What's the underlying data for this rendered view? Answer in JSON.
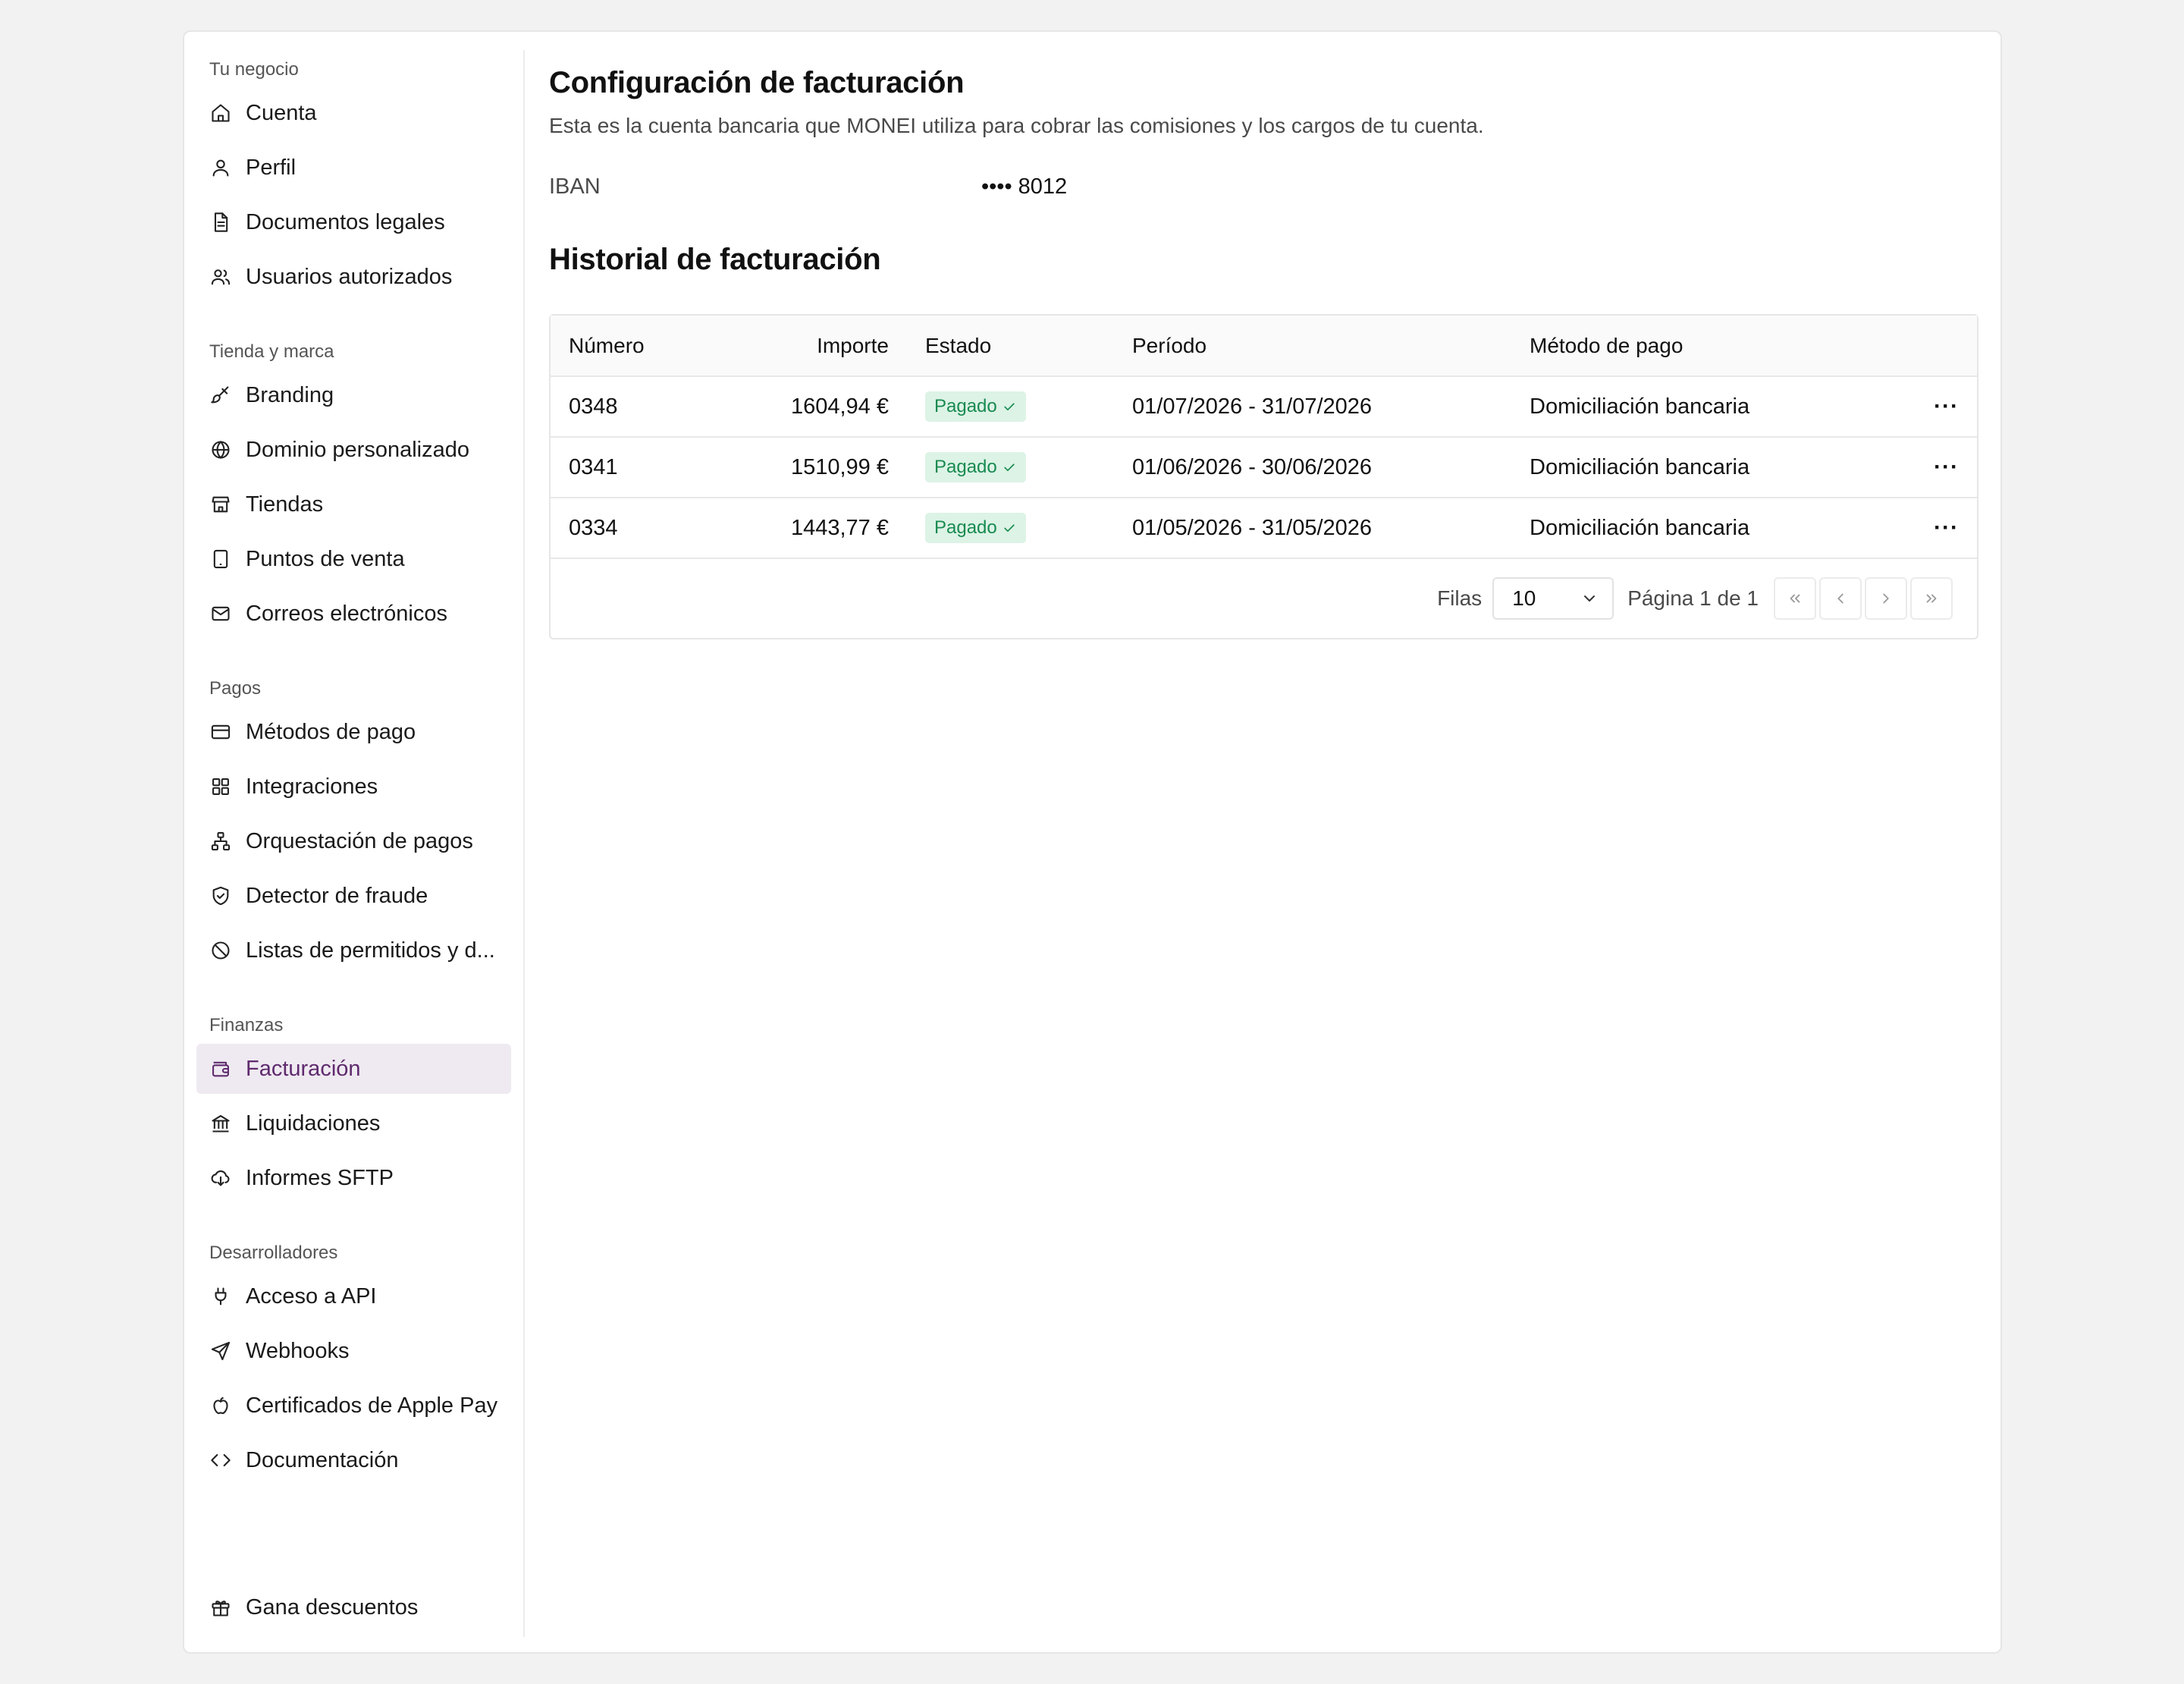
{
  "sidebar": {
    "sections": [
      {
        "title": "Tu negocio",
        "items": [
          {
            "label": "Cuenta",
            "icon": "home-icon"
          },
          {
            "label": "Perfil",
            "icon": "user-icon"
          },
          {
            "label": "Documentos legales",
            "icon": "document-icon"
          },
          {
            "label": "Usuarios autorizados",
            "icon": "users-icon"
          }
        ]
      },
      {
        "title": "Tienda y marca",
        "items": [
          {
            "label": "Branding",
            "icon": "brush-icon"
          },
          {
            "label": "Dominio personalizado",
            "icon": "globe-icon"
          },
          {
            "label": "Tiendas",
            "icon": "store-icon"
          },
          {
            "label": "Puntos de venta",
            "icon": "tablet-icon"
          },
          {
            "label": "Correos electrónicos",
            "icon": "mail-icon"
          }
        ]
      },
      {
        "title": "Pagos",
        "items": [
          {
            "label": "Métodos de pago",
            "icon": "credit-card-icon"
          },
          {
            "label": "Integraciones",
            "icon": "grid-icon"
          },
          {
            "label": "Orquestación de pagos",
            "icon": "network-icon"
          },
          {
            "label": "Detector de fraude",
            "icon": "shield-check-icon"
          },
          {
            "label": "Listas de permitidos y d...",
            "icon": "ban-icon"
          }
        ]
      },
      {
        "title": "Finanzas",
        "items": [
          {
            "label": "Facturación",
            "icon": "wallet-icon",
            "active": true
          },
          {
            "label": "Liquidaciones",
            "icon": "bank-icon"
          },
          {
            "label": "Informes SFTP",
            "icon": "cloud-download-icon"
          }
        ]
      },
      {
        "title": "Desarrolladores",
        "items": [
          {
            "label": "Acceso a API",
            "icon": "plug-icon"
          },
          {
            "label": "Webhooks",
            "icon": "send-icon"
          },
          {
            "label": "Certificados de Apple Pay",
            "icon": "apple-icon"
          },
          {
            "label": "Documentación",
            "icon": "code-icon"
          }
        ]
      }
    ],
    "footer_item": {
      "label": "Gana descuentos",
      "icon": "gift-icon"
    }
  },
  "billing": {
    "title": "Configuración de facturación",
    "description": "Esta es la cuenta bancaria que MONEI utiliza para cobrar las comisiones y los cargos de tu cuenta.",
    "iban_label": "IBAN",
    "iban_value": "•••• 8012"
  },
  "history": {
    "title": "Historial de facturación",
    "columns": {
      "number": "Número",
      "amount": "Importe",
      "status": "Estado",
      "period": "Período",
      "method": "Método de pago"
    },
    "rows": [
      {
        "number": "0348",
        "amount": "1604,94 €",
        "status": "Pagado",
        "period": "01/07/2026 - 31/07/2026",
        "method": "Domiciliación bancaria"
      },
      {
        "number": "0341",
        "amount": "1510,99 €",
        "status": "Pagado",
        "period": "01/06/2026 - 30/06/2026",
        "method": "Domiciliación bancaria"
      },
      {
        "number": "0334",
        "amount": "1443,77 €",
        "status": "Pagado",
        "period": "01/05/2026 - 31/05/2026",
        "method": "Domiciliación bancaria"
      }
    ],
    "pagination": {
      "rows_label": "Filas",
      "rows_value": "10",
      "page_info": "Página 1 de 1"
    }
  },
  "colors": {
    "accent": "#5f2a6e",
    "active_bg": "#efeaf1",
    "status_bg": "#dcf3e6",
    "status_text": "#198a50"
  }
}
